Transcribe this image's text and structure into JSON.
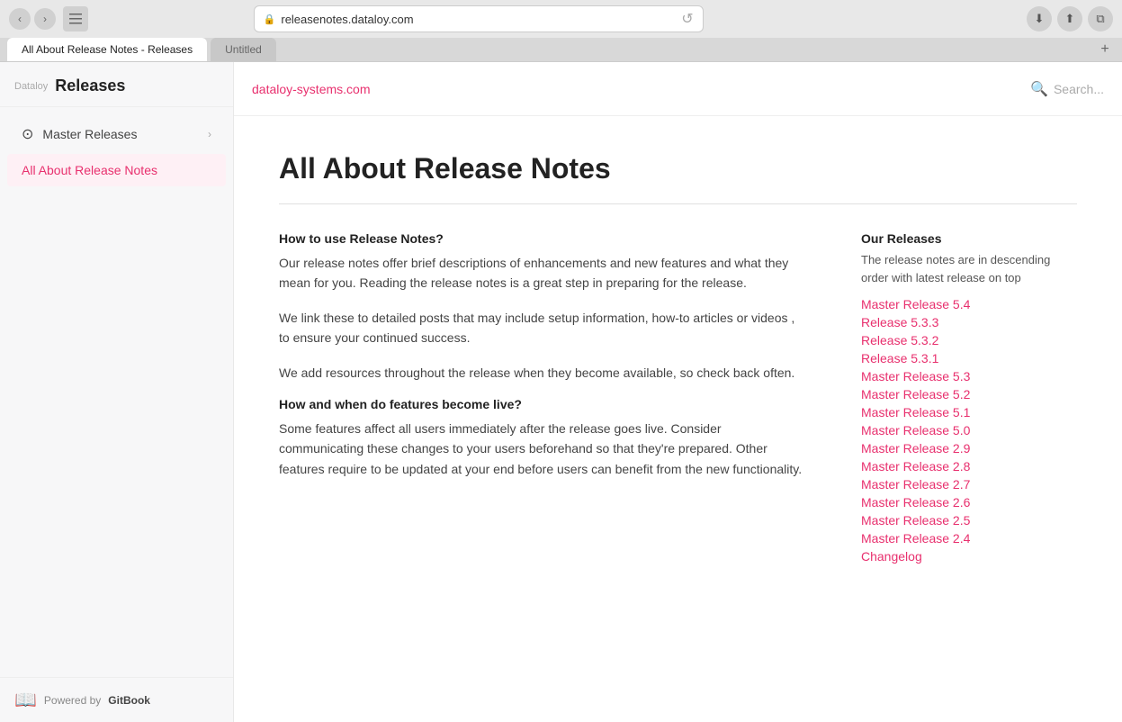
{
  "browser": {
    "url": "releasenotes.dataloy.com",
    "tab_active": "All About Release Notes - Releases",
    "tab_inactive": "Untitled",
    "reload_icon": "↺"
  },
  "sidebar": {
    "brand": "Dataloy",
    "title": "Releases",
    "nav_items": [
      {
        "id": "master-releases",
        "label": "Master Releases",
        "icon": "⊙",
        "has_chevron": true,
        "active": false
      },
      {
        "id": "about-release-notes",
        "label": "All About Release Notes",
        "icon": "",
        "has_chevron": false,
        "active": true
      }
    ],
    "footer_text": "Powered by ",
    "footer_link": "GitBook"
  },
  "topnav": {
    "link_text": "dataloy-systems.com",
    "search_placeholder": "Search..."
  },
  "main": {
    "page_title": "All About Release Notes",
    "section1_heading": "How to use Release Notes?",
    "section1_para1": "Our release notes offer brief descriptions of enhancements and new features and what they mean for you. Reading the release notes is a great step in preparing for the release.",
    "section1_para2": "We link these to detailed posts that may include setup information, how-to articles or videos , to ensure your continued success.",
    "section1_para3": "We add resources throughout the release when they become available, so check back often.",
    "section2_heading": "How and when do features become live?",
    "section2_para": "Some features affect all users immediately after the release goes live. Consider communicating these changes to your users beforehand so that they're prepared. Other features require to be updated at your end before users can benefit from the new functionality.",
    "releases_heading": "Our Releases",
    "releases_subtitle": "The release notes are in descending order with latest release on top",
    "release_links": [
      "Master Release 5.4",
      "Release 5.3.3",
      "Release 5.3.2",
      "Release 5.3.1",
      "Master Release 5.3",
      "Master Release 5.2",
      "Master Release 5.1",
      "Master Release 5.0",
      "Master Release 2.9",
      "Master Release 2.8",
      "Master Release 2.7",
      "Master Release 2.6",
      "Master Release 2.5",
      "Master Release 2.4",
      "Changelog"
    ]
  }
}
